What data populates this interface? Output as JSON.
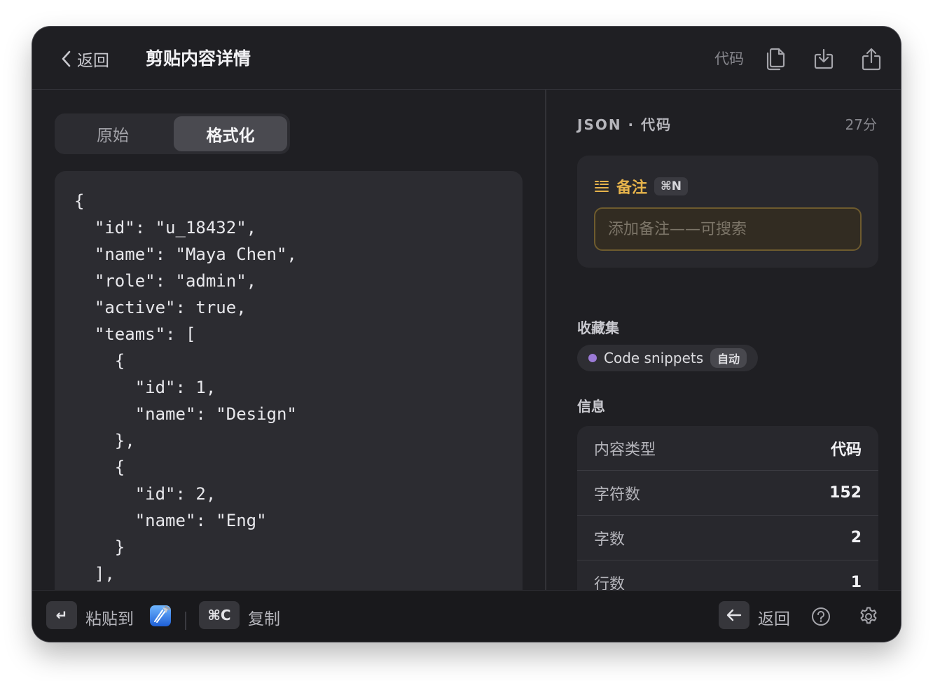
{
  "header": {
    "back_label": "返回",
    "title": "剪贴内容详情",
    "type_label": "代码",
    "icons": [
      "copy-icon",
      "download-icon",
      "share-icon"
    ]
  },
  "tabs": {
    "raw_label": "原始",
    "formatted_label": "格式化",
    "active": "格式化"
  },
  "code": {
    "text": "{\n  \"id\": \"u_18432\",\n  \"name\": \"Maya Chen\",\n  \"role\": \"admin\",\n  \"active\": true,\n  \"teams\": [\n    {\n      \"id\": 1,\n      \"name\": \"Design\"\n    },\n    {\n      \"id\": 2,\n      \"name\": \"Eng\"\n    }\n  ],"
  },
  "meta": {
    "title": "JSON · 代码",
    "time": "27分"
  },
  "note": {
    "label": "备注",
    "shortcut": "⌘N",
    "value": "",
    "placeholder": "添加备注——可搜索",
    "accent_color": "#e6b34b"
  },
  "collections": {
    "label": "收藏集",
    "items": [
      {
        "name": "Code snippets",
        "badge": "自动",
        "color": "#9b7ad6"
      }
    ]
  },
  "info": {
    "label": "信息",
    "rows": [
      {
        "key": "内容类型",
        "value": "代码"
      },
      {
        "key": "字符数",
        "value": "152"
      },
      {
        "key": "字数",
        "value": "2"
      },
      {
        "key": "行数",
        "value": "1"
      }
    ]
  },
  "footer": {
    "enter_key": "↵",
    "paste_label": "粘贴到",
    "copy_shortcut": "⌘C",
    "copy_label": "复制",
    "back_key": "←",
    "back_label": "返回",
    "icons": [
      "help-icon",
      "gear-icon"
    ]
  }
}
